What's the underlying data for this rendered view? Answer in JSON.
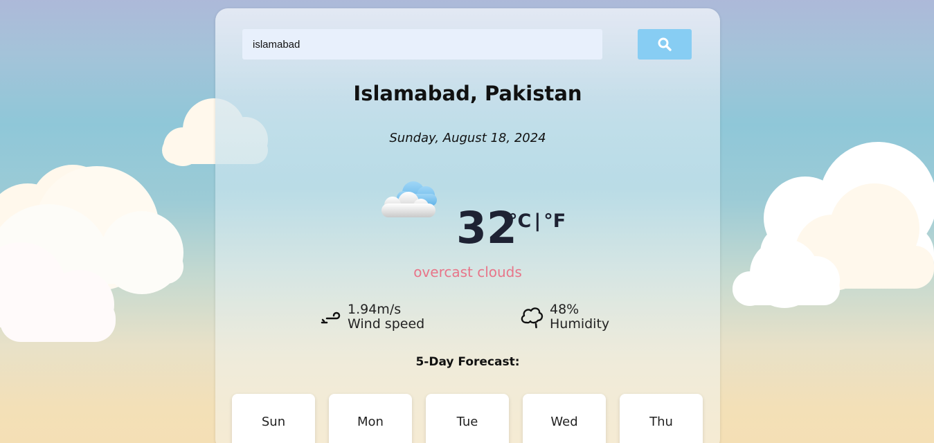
{
  "search": {
    "value": "islamabad",
    "button_icon": "search-icon"
  },
  "weather": {
    "location": "Islamabad, Pakistan",
    "date": "Sunday, August 18, 2024",
    "icon": "overcast-cloud-icon",
    "temperature": "32",
    "unit_celsius": "°C",
    "unit_separator": "|",
    "unit_fahrenheit": "°F",
    "condition": "overcast clouds",
    "wind": {
      "icon": "wind-icon",
      "value": "1.94m/s",
      "label": "Wind speed"
    },
    "humidity": {
      "icon": "humidity-icon",
      "value": "48%",
      "label": "Humidity"
    }
  },
  "forecast": {
    "title": "5-Day Forecast:",
    "days": [
      {
        "label": "Sun"
      },
      {
        "label": "Mon"
      },
      {
        "label": "Tue"
      },
      {
        "label": "Wed"
      },
      {
        "label": "Thu"
      }
    ]
  },
  "colors": {
    "search_button": "#87cdf3",
    "condition_text": "#e87589",
    "temperature_text": "#1e2233"
  }
}
